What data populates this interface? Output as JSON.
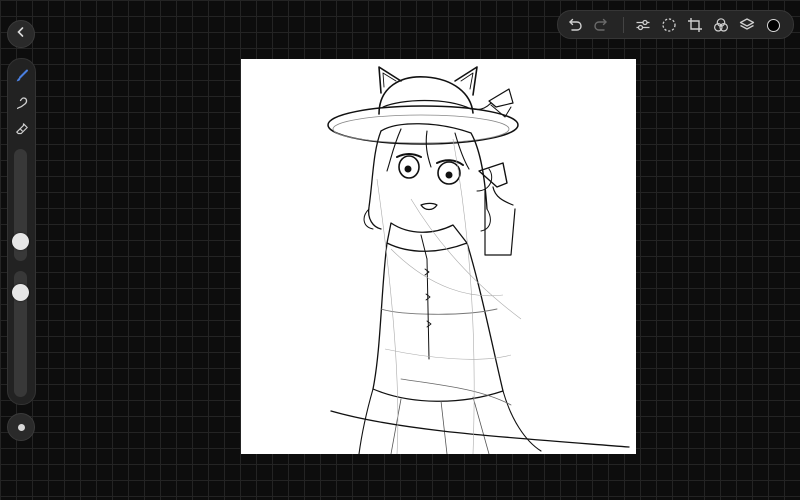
{
  "left_panel": {
    "tools": [
      {
        "name": "brush-icon",
        "active": true
      },
      {
        "name": "smudge-icon",
        "active": false
      },
      {
        "name": "eraser-icon",
        "active": false
      }
    ],
    "brush_size_level": 0.12,
    "brush_opacity_level": 0.88
  },
  "top_toolbar": {
    "icons": [
      "undo-icon",
      "redo-icon",
      "adjustments-icon",
      "selection-icon",
      "transform-icon",
      "blend-icon",
      "layers-icon"
    ],
    "current_color": "#000000"
  },
  "canvas": {
    "background": "#ffffff",
    "content": "line-sketch-artwork"
  },
  "colors": {
    "accent": "#4a7fe0",
    "background": "#0d0d0d",
    "panel": "#222222"
  }
}
